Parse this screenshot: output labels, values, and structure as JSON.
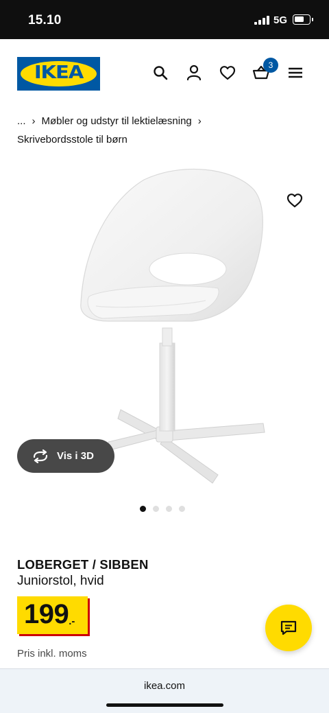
{
  "status_bar": {
    "time": "15.10",
    "network": "5G"
  },
  "header": {
    "logo_text": "IKEA",
    "cart_count": "3"
  },
  "breadcrumb": {
    "ellipsis": "...",
    "category": "Møbler og udstyr til lektielæsning",
    "current": "Skrivebordsstole til børn"
  },
  "gallery": {
    "view_3d_label": "Vis i 3D",
    "image_count": 4,
    "active_image": 1
  },
  "product": {
    "name": "LOBERGET / SIBBEN",
    "description": "Juniorstol, hvid",
    "price": "199",
    "price_suffix": ".-",
    "price_note": "Pris inkl. moms"
  },
  "browser": {
    "url": "ikea.com"
  },
  "colors": {
    "brand_blue": "#0058a3",
    "brand_yellow": "#ffdb00",
    "price_red": "#cc0008",
    "button_dark": "#484848"
  },
  "icons": [
    "search-icon",
    "account-icon",
    "favourites-icon",
    "cart-icon",
    "menu-icon",
    "heart-icon",
    "rotate-3d-icon",
    "chat-icon"
  ]
}
